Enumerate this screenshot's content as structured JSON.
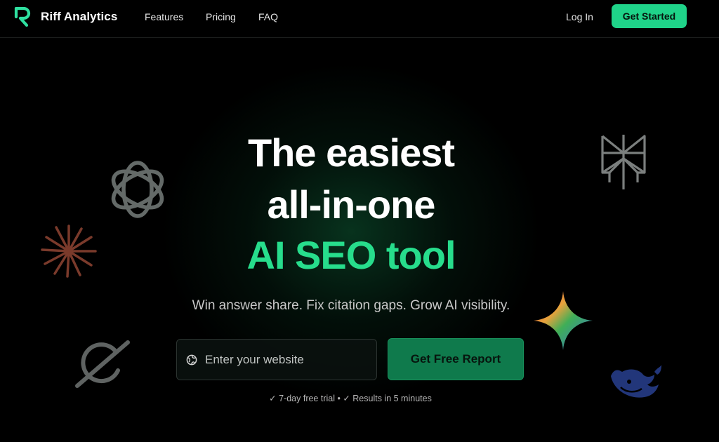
{
  "nav": {
    "brand": "Riff Analytics",
    "links": [
      "Features",
      "Pricing",
      "FAQ"
    ],
    "login": "Log In",
    "cta": "Get Started"
  },
  "hero": {
    "line1": "The easiest",
    "line2": "all-in-one",
    "line3": "AI SEO tool",
    "subtitle": "Win answer share. Fix citation gaps. Grow AI visibility.",
    "input_placeholder": "Enter your website",
    "button": "Get Free Report",
    "footnote": "✓ 7-day free trial • ✓ Results in 5 minutes"
  },
  "colors": {
    "accent": "#27dd8c",
    "cta_bg": "#1fd389",
    "report_bg": "#0f7a4c"
  },
  "icons": [
    "openai-logo-icon",
    "claude-burst-icon",
    "grok-logo-icon",
    "perplexity-logo-icon",
    "gemini-star-icon",
    "deepseek-whale-icon",
    "globe-icon"
  ]
}
